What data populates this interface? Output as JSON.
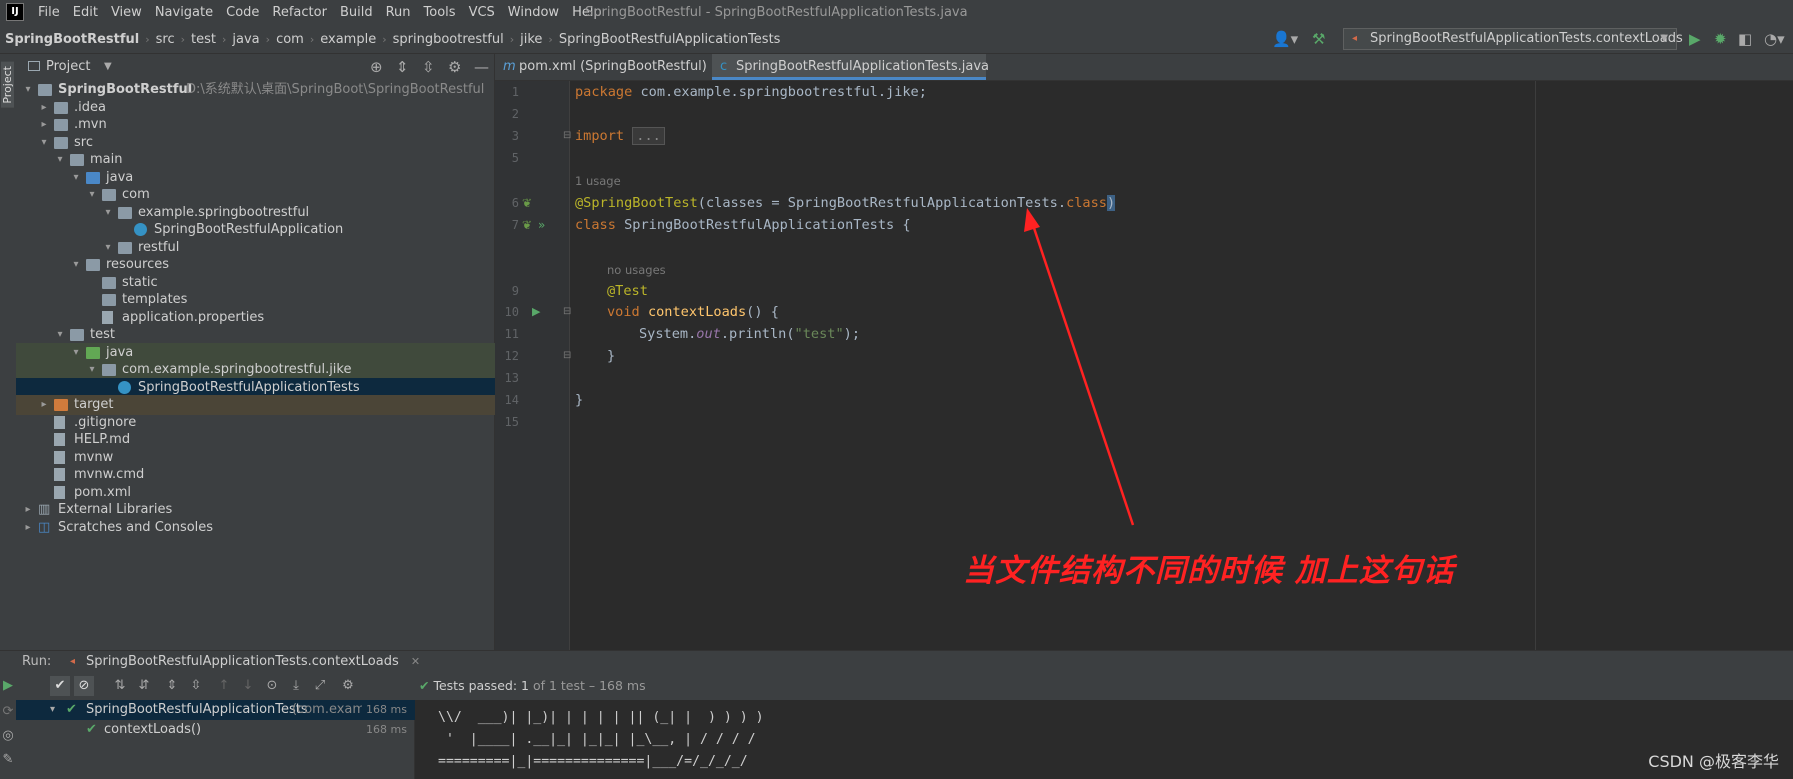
{
  "menu": {
    "logo": "IJ",
    "items": [
      "File",
      "Edit",
      "View",
      "Navigate",
      "Code",
      "Refactor",
      "Build",
      "Run",
      "Tools",
      "VCS",
      "Window",
      "Help"
    ],
    "window_title": "SpringBootRestful - SpringBootRestfulApplicationTests.java"
  },
  "breadcrumb": [
    "SpringBootRestful",
    "src",
    "test",
    "java",
    "com",
    "example",
    "springbootrestful",
    "jike",
    "SpringBootRestfulApplicationTests"
  ],
  "run_config": {
    "label": "SpringBootRestfulApplicationTests.contextLoads"
  },
  "left_strip": {
    "label": "Project"
  },
  "project": {
    "title": "Project",
    "tree": [
      {
        "label": "SpringBootRestful",
        "path": "D:\\系统默认\\桌面\\SpringBoot\\SpringBootRestful",
        "depth": 0,
        "arrow": "▾",
        "icon": "folder",
        "bold": true
      },
      {
        "label": ".idea",
        "depth": 1,
        "arrow": "▸",
        "icon": "folder"
      },
      {
        "label": ".mvn",
        "depth": 1,
        "arrow": "▸",
        "icon": "folder"
      },
      {
        "label": "src",
        "depth": 1,
        "arrow": "▾",
        "icon": "folder"
      },
      {
        "label": "main",
        "depth": 2,
        "arrow": "▾",
        "icon": "folder"
      },
      {
        "label": "java",
        "depth": 3,
        "arrow": "▾",
        "icon": "folder-blue"
      },
      {
        "label": "com",
        "depth": 4,
        "arrow": "▾",
        "icon": "folder-pkg"
      },
      {
        "label": "example.springbootrestful",
        "depth": 5,
        "arrow": "▾",
        "icon": "folder-pkg"
      },
      {
        "label": "SpringBootRestfulApplication",
        "depth": 6,
        "arrow": "",
        "icon": "jclass"
      },
      {
        "label": "restful",
        "depth": 5,
        "arrow": "▾",
        "icon": "folder-pkg"
      },
      {
        "label": "resources",
        "depth": 3,
        "arrow": "▾",
        "icon": "folder"
      },
      {
        "label": "static",
        "depth": 4,
        "arrow": "",
        "icon": "folder"
      },
      {
        "label": "templates",
        "depth": 4,
        "arrow": "",
        "icon": "folder"
      },
      {
        "label": "application.properties",
        "depth": 4,
        "arrow": "",
        "icon": "file"
      },
      {
        "label": "test",
        "depth": 2,
        "arrow": "▾",
        "icon": "folder"
      },
      {
        "label": "java",
        "depth": 3,
        "arrow": "▾",
        "icon": "folder-green",
        "sel": "green"
      },
      {
        "label": "com.example.springbootrestful.jike",
        "depth": 4,
        "arrow": "▾",
        "icon": "folder-pkg",
        "sel": "green"
      },
      {
        "label": "SpringBootRestfulApplicationTests",
        "depth": 5,
        "arrow": "",
        "icon": "jclass",
        "sel": "blue"
      },
      {
        "label": "target",
        "depth": 1,
        "arrow": "▸",
        "icon": "folder-orange",
        "sel": "brown"
      },
      {
        "label": ".gitignore",
        "depth": 1,
        "arrow": "",
        "icon": "file"
      },
      {
        "label": "HELP.md",
        "depth": 1,
        "arrow": "",
        "icon": "file"
      },
      {
        "label": "mvnw",
        "depth": 1,
        "arrow": "",
        "icon": "file"
      },
      {
        "label": "mvnw.cmd",
        "depth": 1,
        "arrow": "",
        "icon": "file"
      },
      {
        "label": "pom.xml",
        "depth": 1,
        "arrow": "",
        "icon": "file"
      },
      {
        "label": "External Libraries",
        "depth": 0,
        "arrow": "▸",
        "icon": "lib"
      },
      {
        "label": "Scratches and Consoles",
        "depth": 0,
        "arrow": "▸",
        "icon": "scratch"
      }
    ]
  },
  "tabs": [
    {
      "icon": "m",
      "label": "pom.xml (SpringBootRestful)",
      "active": false
    },
    {
      "icon": "c",
      "label": "SpringBootRestfulApplicationTests.java",
      "active": true
    }
  ],
  "editor": {
    "line_numbers": [
      "1",
      "2",
      "3",
      "5",
      "6",
      "7",
      "9",
      "10",
      "11",
      "12",
      "13",
      "14",
      "15"
    ],
    "hints": {
      "usage": "1 usage",
      "no_usages": "no usages"
    },
    "code": {
      "l1_kw": "package",
      "l1_rest": " com.example.springbootrestful.jike;",
      "l3_kw": "import",
      "l3_fold": "...",
      "l6_ann": "@SpringBootTest",
      "l6_a": "(classes = SpringBootRestfulApplicationTests.",
      "l6_kw": "class",
      "l6_close": ")",
      "l7_kw": "class",
      "l7_rest": " SpringBootRestfulApplicationTests {",
      "l9_ann": "@Test",
      "l10_kw": "void",
      "l10_fn": "contextLoads",
      "l10_rest": "() {",
      "l11_a": "System.",
      "l11_it": "out",
      "l11_b": ".println(",
      "l11_str": "\"test\"",
      "l11_c": ");",
      "l12": "}",
      "l14": "}"
    }
  },
  "annotation": "当文件结构不同的时候 加上这句话",
  "run": {
    "label": "Run:",
    "tab": "SpringBootRestfulApplicationTests.contextLoads",
    "status_prefix": "Tests passed:",
    "status_count": "1",
    "status_suffix": "of 1 test – 168 ms",
    "tree": [
      {
        "label": "SpringBootRestfulApplicationTests",
        "pkg": "(com.example",
        "ms": "168 ms"
      },
      {
        "label": "contextLoads()",
        "ms": "168 ms"
      }
    ],
    "console": [
      "\\\\/  ___)| |_)| | | | | || (_| |  ) ) ) )",
      " '  |____| .__|_| |_|_| |_\\__, | / / / /",
      "=========|_|==============|___/=/_/_/_/"
    ]
  },
  "watermark": "CSDN @极客李华"
}
